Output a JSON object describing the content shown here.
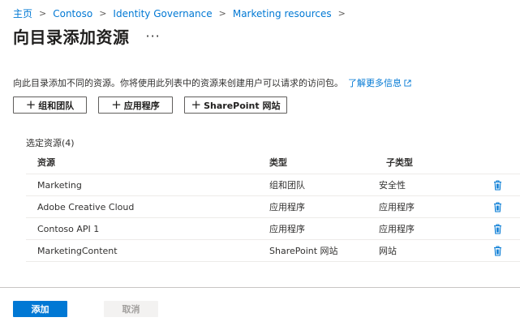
{
  "breadcrumb": [
    "主页",
    "Contoso",
    "Identity Governance",
    "Marketing resources"
  ],
  "header": {
    "title": "向目录添加资源",
    "more": "···"
  },
  "description": {
    "text": "向此目录添加不同的资源。你将使用此列表中的资源来创建用户可以请求的访问包。",
    "link": "了解更多信息"
  },
  "add_buttons": {
    "groups": "组和团队",
    "apps": "应用程序",
    "sharepoint": "SharePoint 网站"
  },
  "selected": {
    "label": "选定资源(4)",
    "columns": [
      "资源",
      "类型",
      "子类型"
    ],
    "rows": [
      {
        "resource": "Marketing",
        "type": "组和团队",
        "subtype": "安全性"
      },
      {
        "resource": "Adobe Creative Cloud",
        "type": "应用程序",
        "subtype": "应用程序"
      },
      {
        "resource": "Contoso API 1",
        "type": "应用程序",
        "subtype": "应用程序"
      },
      {
        "resource": "MarketingContent",
        "type": "SharePoint 网站",
        "subtype": "网站"
      }
    ]
  },
  "footer": {
    "add": "添加",
    "cancel": "取消"
  },
  "colors": {
    "accent": "#0078d4",
    "text": "#323130",
    "disabled_bg": "#f3f2f1",
    "disabled_text": "#a19f9d"
  },
  "icons": [
    "chevron-right-icon",
    "ellipsis-icon",
    "external-link-icon",
    "plus-icon",
    "trash-icon"
  ]
}
